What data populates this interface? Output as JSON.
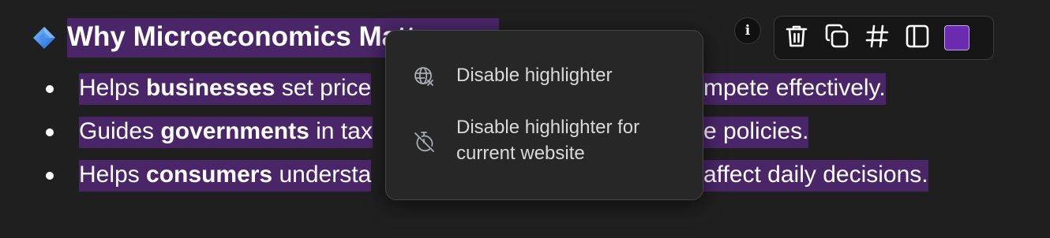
{
  "document": {
    "heading": "Why Microeconomics Matters",
    "bullets": [
      {
        "prefix": "Helps ",
        "bold": "businesses",
        "suffix": " set price",
        "tail": "mpete effectively."
      },
      {
        "prefix": "Guides ",
        "bold": "governments",
        "suffix": " in tax",
        "tail": "e policies."
      },
      {
        "prefix": "Helps ",
        "bold": "consumers",
        "suffix": " understa",
        "tail": "affect daily decisions."
      }
    ]
  },
  "highlight_color": "#4a2668",
  "info_button": {
    "label": "i"
  },
  "toolbar": {
    "buttons": [
      "trash-icon",
      "copy-icon",
      "hash-icon",
      "sidebar-icon"
    ],
    "swatch_color": "#6a2bb1"
  },
  "menu": {
    "items": [
      {
        "icon": "globe-x-icon",
        "label_lines": [
          "Disable highlighter"
        ]
      },
      {
        "icon": "timer-off-icon",
        "label_lines": [
          "Disable highlighter for",
          "current website"
        ]
      }
    ]
  }
}
